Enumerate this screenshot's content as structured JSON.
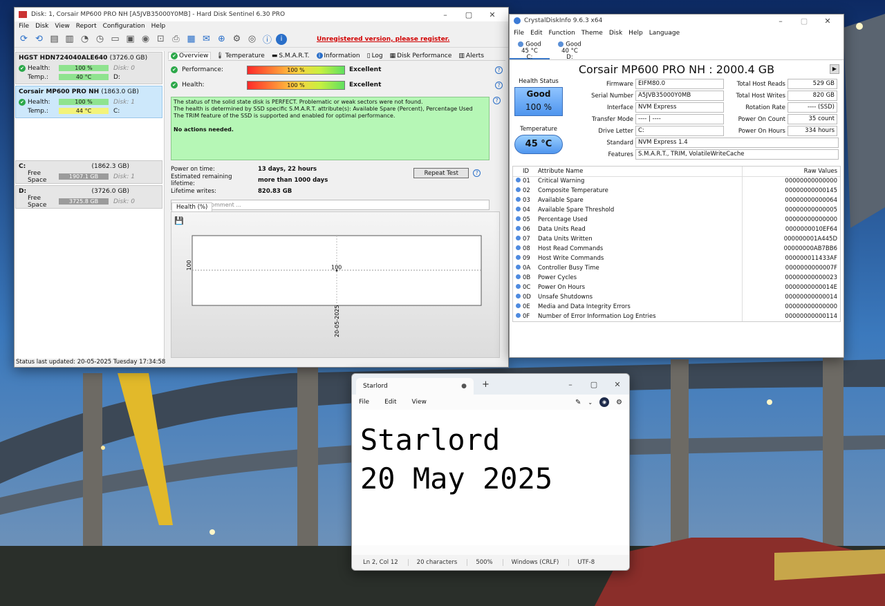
{
  "hds": {
    "title": "Disk: 1, Corsair MP600 PRO NH [A5JVB35000Y0MB]  -  Hard Disk Sentinel 6.30 PRO",
    "menu": [
      "File",
      "Disk",
      "View",
      "Report",
      "Configuration",
      "Help"
    ],
    "unregistered": "Unregistered version, please register.",
    "disks": [
      {
        "name": "HGST HDN724040ALE640",
        "size": "(3726.0 GB)",
        "health_label": "Health:",
        "health": "100 %",
        "health_pct": 100,
        "disk_label": "Disk: 0",
        "temp_label": "Temp.:",
        "temp": "40 °C",
        "drive": "D:"
      },
      {
        "name": "Corsair MP600 PRO NH",
        "size": "(1863.0 GB)",
        "health_label": "Health:",
        "health": "100 %",
        "health_pct": 100,
        "disk_label": "Disk: 1",
        "temp_label": "Temp.:",
        "temp": "44 °C",
        "drive": "C:"
      }
    ],
    "volumes": [
      {
        "letter": "C:",
        "size": "(1862.3 GB)",
        "free_label": "Free Space",
        "free": "1907.1 GB",
        "disk": "Disk: 1"
      },
      {
        "letter": "D:",
        "size": "(3726.0 GB)",
        "free_label": "Free Space",
        "free": "3725.8 GB",
        "disk": "Disk: 0"
      }
    ],
    "tabs": [
      "Overview",
      "Temperature",
      "S.M.A.R.T.",
      "Information",
      "Log",
      "Disk Performance",
      "Alerts"
    ],
    "performance_label": "Performance:",
    "performance_value": "100 %",
    "performance_pct": 100,
    "performance_text": "Excellent",
    "health_label": "Health:",
    "health_value": "100 %",
    "health_pct": 100,
    "health_text": "Excellent",
    "message": [
      "The status of the solid state disk is PERFECT. Problematic or weak sectors were not found.",
      "The health is determined by SSD specific S.M.A.R.T. attribute(s):  Available Spare (Percent), Percentage Used",
      "The TRIM feature of the SSD is supported and enabled for optimal performance."
    ],
    "message_action": "No actions needed.",
    "power_on_label": "Power on time:",
    "power_on": "13 days, 22 hours",
    "remaining_label": "Estimated remaining lifetime:",
    "remaining": "more than 1000 days",
    "writes_label": "Lifetime writes:",
    "writes": "820.83 GB",
    "repeat_test": "Repeat Test",
    "comment_placeholder": "Click to add comment ...",
    "chart_tab": "Health (%)",
    "status": "Status last updated: 20-05-2025 Tuesday 17:34:58"
  },
  "chart_data": {
    "type": "line",
    "title": "",
    "xlabel": "",
    "ylabel": "",
    "x": [
      "20-05-2025"
    ],
    "y_tick": "100",
    "series": [
      {
        "values": [
          100
        ]
      }
    ],
    "point_label": "100",
    "ylim": [
      99,
      101
    ]
  },
  "cdi": {
    "title": "CrystalDiskInfo 9.6.3 x64",
    "menu": [
      "File",
      "Edit",
      "Function",
      "Theme",
      "Disk",
      "Help",
      "Language"
    ],
    "drives": [
      {
        "status": "Good",
        "temp": "45 °C",
        "letter": "C:"
      },
      {
        "status": "Good",
        "temp": "40 °C",
        "letter": "D:"
      }
    ],
    "model": "Corsair MP600 PRO NH : 2000.4 GB",
    "health_status_label": "Health Status",
    "health_status": "Good",
    "health_percent": "100 %",
    "temperature_label": "Temperature",
    "temperature": "45 °C",
    "fields": {
      "firmware_label": "Firmware",
      "firmware": "EIFM80.0",
      "serial_label": "Serial Number",
      "serial": "A5JVB35000Y0MB",
      "interface_label": "Interface",
      "interface": "NVM Express",
      "transfer_label": "Transfer Mode",
      "transfer": "---- | ----",
      "letter_label": "Drive Letter",
      "letter": "C:",
      "standard_label": "Standard",
      "standard": "NVM Express 1.4",
      "features_label": "Features",
      "features": "S.M.A.R.T., TRIM, VolatileWriteCache",
      "reads_label": "Total Host Reads",
      "reads": "529 GB",
      "writes_label": "Total Host Writes",
      "writes": "820 GB",
      "rotation_label": "Rotation Rate",
      "rotation": "---- (SSD)",
      "count_label": "Power On Count",
      "count": "35 count",
      "hours_label": "Power On Hours",
      "hours": "334 hours"
    },
    "attr_headers": {
      "id": "ID",
      "name": "Attribute Name",
      "raw": "Raw Values"
    },
    "attributes": [
      {
        "id": "01",
        "name": "Critical Warning",
        "raw": "00000000000000"
      },
      {
        "id": "02",
        "name": "Composite Temperature",
        "raw": "00000000000145"
      },
      {
        "id": "03",
        "name": "Available Spare",
        "raw": "00000000000064"
      },
      {
        "id": "04",
        "name": "Available Spare Threshold",
        "raw": "00000000000005"
      },
      {
        "id": "05",
        "name": "Percentage Used",
        "raw": "00000000000000"
      },
      {
        "id": "06",
        "name": "Data Units Read",
        "raw": "0000000010EF64"
      },
      {
        "id": "07",
        "name": "Data Units Written",
        "raw": "000000001A445D"
      },
      {
        "id": "08",
        "name": "Host Read Commands",
        "raw": "00000000AB7BB6"
      },
      {
        "id": "09",
        "name": "Host Write Commands",
        "raw": "000000011433AF"
      },
      {
        "id": "0A",
        "name": "Controller Busy Time",
        "raw": "0000000000007F"
      },
      {
        "id": "0B",
        "name": "Power Cycles",
        "raw": "00000000000023"
      },
      {
        "id": "0C",
        "name": "Power On Hours",
        "raw": "0000000000014E"
      },
      {
        "id": "0D",
        "name": "Unsafe Shutdowns",
        "raw": "00000000000014"
      },
      {
        "id": "0E",
        "name": "Media and Data Integrity Errors",
        "raw": "00000000000000"
      },
      {
        "id": "0F",
        "name": "Number of Error Information Log Entries",
        "raw": "00000000000114"
      }
    ]
  },
  "notepad": {
    "tab_title": "Starlord",
    "menu": [
      "File",
      "Edit",
      "View"
    ],
    "content_line1": "Starlord",
    "content_line2": "20 May 2025",
    "status": [
      "Ln 2, Col 12",
      "20 characters",
      "500%",
      "Windows (CRLF)",
      "UTF-8"
    ]
  },
  "icons": [
    "minimize-icon",
    "maximize-icon",
    "close-icon",
    "refresh-icon",
    "check-icon",
    "help-icon",
    "info-icon",
    "save-icon",
    "settings-icon",
    "plus-icon"
  ]
}
